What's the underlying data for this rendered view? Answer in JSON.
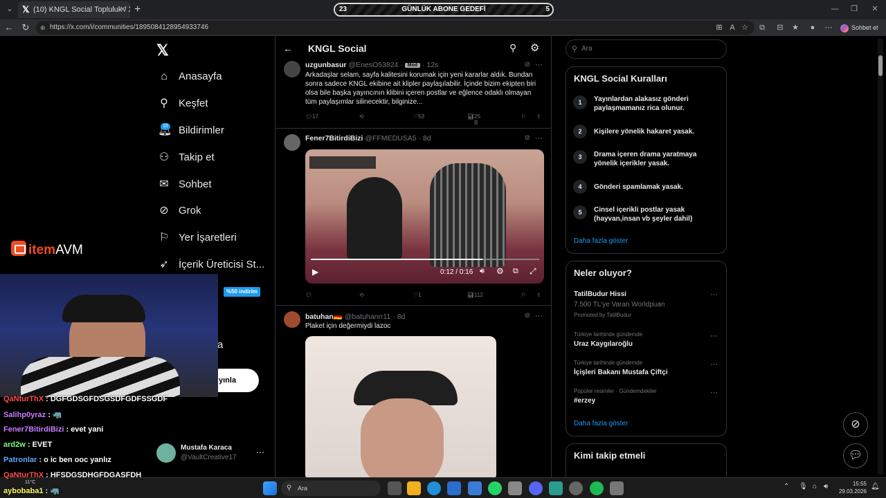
{
  "browser": {
    "tab_title": "(10) KNGL Social Topluluk / X",
    "url": "https://x.com/i/communities/1895084128954933746",
    "copilot_label": "Sohbet et"
  },
  "stream_goal": {
    "title": "GÜNLÜK ABONE GEDEFİ",
    "current": "23",
    "target": "5"
  },
  "left_nav": {
    "items": [
      {
        "label": "Anasayfa",
        "icon": "home-icon"
      },
      {
        "label": "Keşfet",
        "icon": "search-icon"
      },
      {
        "label": "Bildirimler",
        "icon": "bell-icon"
      },
      {
        "label": "Takip et",
        "icon": "follow-icon"
      },
      {
        "label": "Sohbet",
        "icon": "mail-icon"
      },
      {
        "label": "Grok",
        "icon": "grok-icon"
      },
      {
        "label": "Yer İşaretleri",
        "icon": "bookmark-icon"
      },
      {
        "label": "İçerik Üreticisi St...",
        "icon": "rocket-icon"
      }
    ],
    "notification_badge": "10",
    "partial_label": "a",
    "post_button_partial": "yınla",
    "account": {
      "name": "Mustafa Karaca",
      "handle": "@VaultCreative17"
    }
  },
  "timeline": {
    "title": "KNGL Social",
    "posts": [
      {
        "name": "uzgunbasur",
        "handle": "@EnesO53824",
        "tag": "Mod",
        "time": "12s",
        "text": "Arkadaşlar selam, sayfa kalitesini korumak için yeni kararlar aldık. Bundan sonra sadece KNGL ekibine ait klipler paylaşılabilir. İçinde bizim ekipten biri olsa bile başka yayıncının klibini içeren postlar ve eğlence odaklı olmayan tüm paylaşımlar silinecektir, bilginize...",
        "replies": "17",
        "likes": "53",
        "views": "25 B"
      },
      {
        "name": "Fener7BitirdiBizi",
        "handle": "@FFMEDUSA5",
        "time": "8d",
        "video_time": "0:12 / 0:16",
        "likes": "1",
        "views": "112"
      },
      {
        "name": "batuhan🇩🇪",
        "handle": "@batuhanrr11",
        "time": "8d",
        "text": "Plaket için değermiydi lazoc"
      }
    ]
  },
  "right_panel": {
    "search_placeholder": "Ara",
    "rules_title": "KNGL Social Kuralları",
    "rules": [
      {
        "num": "1",
        "text": "Yayınlardan alakasız gönderi paylaşmamanız rica olunur."
      },
      {
        "num": "2",
        "text": "Kişilere yönelik hakaret yasak."
      },
      {
        "num": "3",
        "text": "Drama içeren drama yaratmaya yönelik içerikler yasak."
      },
      {
        "num": "4",
        "text": "Gönderi spamlamak yasak."
      },
      {
        "num": "5",
        "text": "Cinsel içerikli postlar yasak (hayvan,insan vb şeyler dahil)"
      }
    ],
    "show_more": "Daha fazla göster",
    "trends_title": "Neler oluyor?",
    "trends": [
      {
        "title": "TatilBudur Hissi",
        "sub": "7.500 TL'ye Varan Worldpuan",
        "promo": "Promoted by TatilBudur"
      },
      {
        "context": "Türkiye tarihinde gündemde",
        "title": "Uraz Kaygılaroğlu"
      },
      {
        "context": "Türkiye tarihinde gündemde",
        "title": "İçişleri Bakanı Mustafa Çiftçi"
      },
      {
        "context": "Popüler resimler · Gündemdekiler",
        "title": "#erzey"
      }
    ],
    "trends_more": "Daha fazla göster",
    "follow_title": "Kimi takip etmeli"
  },
  "overlay": {
    "brand_part1": "item",
    "brand_part2": "AVM",
    "discount": "%50 indirim",
    "chat": [
      {
        "user": "QaNturThX",
        "msg": ": DGFGDSGFDSGSDFGDFSSGDF",
        "color": "#ff4d4d"
      },
      {
        "user": "Salihp0yraz",
        "msg": ": 🦏",
        "color": "#c77dff"
      },
      {
        "user": "Fener7BitirdiBizi",
        "msg": ": evet yani",
        "color": "#c77dff"
      },
      {
        "user": "ard2w",
        "msg": ": EVET",
        "color": "#7dff7d"
      },
      {
        "user": "Patronlar",
        "msg": ": o ic ben ooc yanlız",
        "color": "#5aa9ff"
      },
      {
        "user": "QaNturThX",
        "msg": ": HFSDGSDHGFDGASFDH",
        "color": "#ff4d4d"
      },
      {
        "user": "aybobaba1",
        "msg": ": 🦏",
        "color": "#ffff66"
      }
    ]
  },
  "taskbar": {
    "search": "Ara",
    "time": "15:55",
    "date": "29.03.2026",
    "weather": "11°C"
  }
}
